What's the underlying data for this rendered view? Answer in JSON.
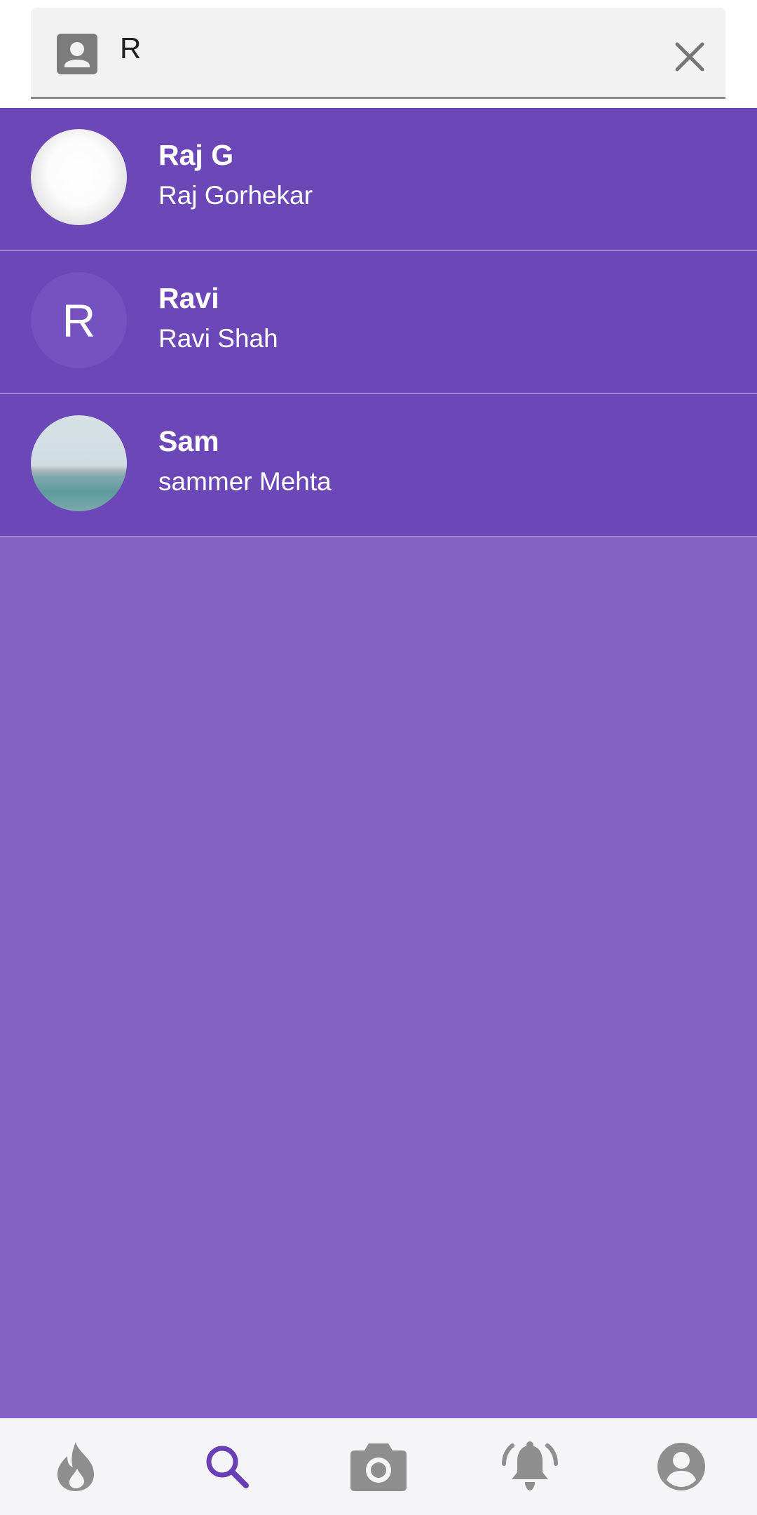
{
  "search": {
    "value": "R",
    "placeholder": ""
  },
  "icons": {
    "contact": "contact-icon",
    "clear": "close-icon",
    "nav": [
      "flame-icon",
      "search-icon",
      "camera-icon",
      "bell-icon",
      "account-icon"
    ]
  },
  "results": [
    {
      "name": "Raj G",
      "fullname": "Raj Gorhekar",
      "avatar_type": "photo"
    },
    {
      "name": "Ravi",
      "fullname": "Ravi Shah",
      "avatar_type": "letter",
      "avatar_letter": "R"
    },
    {
      "name": "Sam",
      "fullname": "sammer Mehta",
      "avatar_type": "photo"
    }
  ],
  "nav": {
    "active_index": 1
  },
  "colors": {
    "primary": "#6b47b7",
    "background": "#8362c3",
    "nav_active": "#6a3fb6",
    "nav_inactive": "#8e8e8e"
  }
}
